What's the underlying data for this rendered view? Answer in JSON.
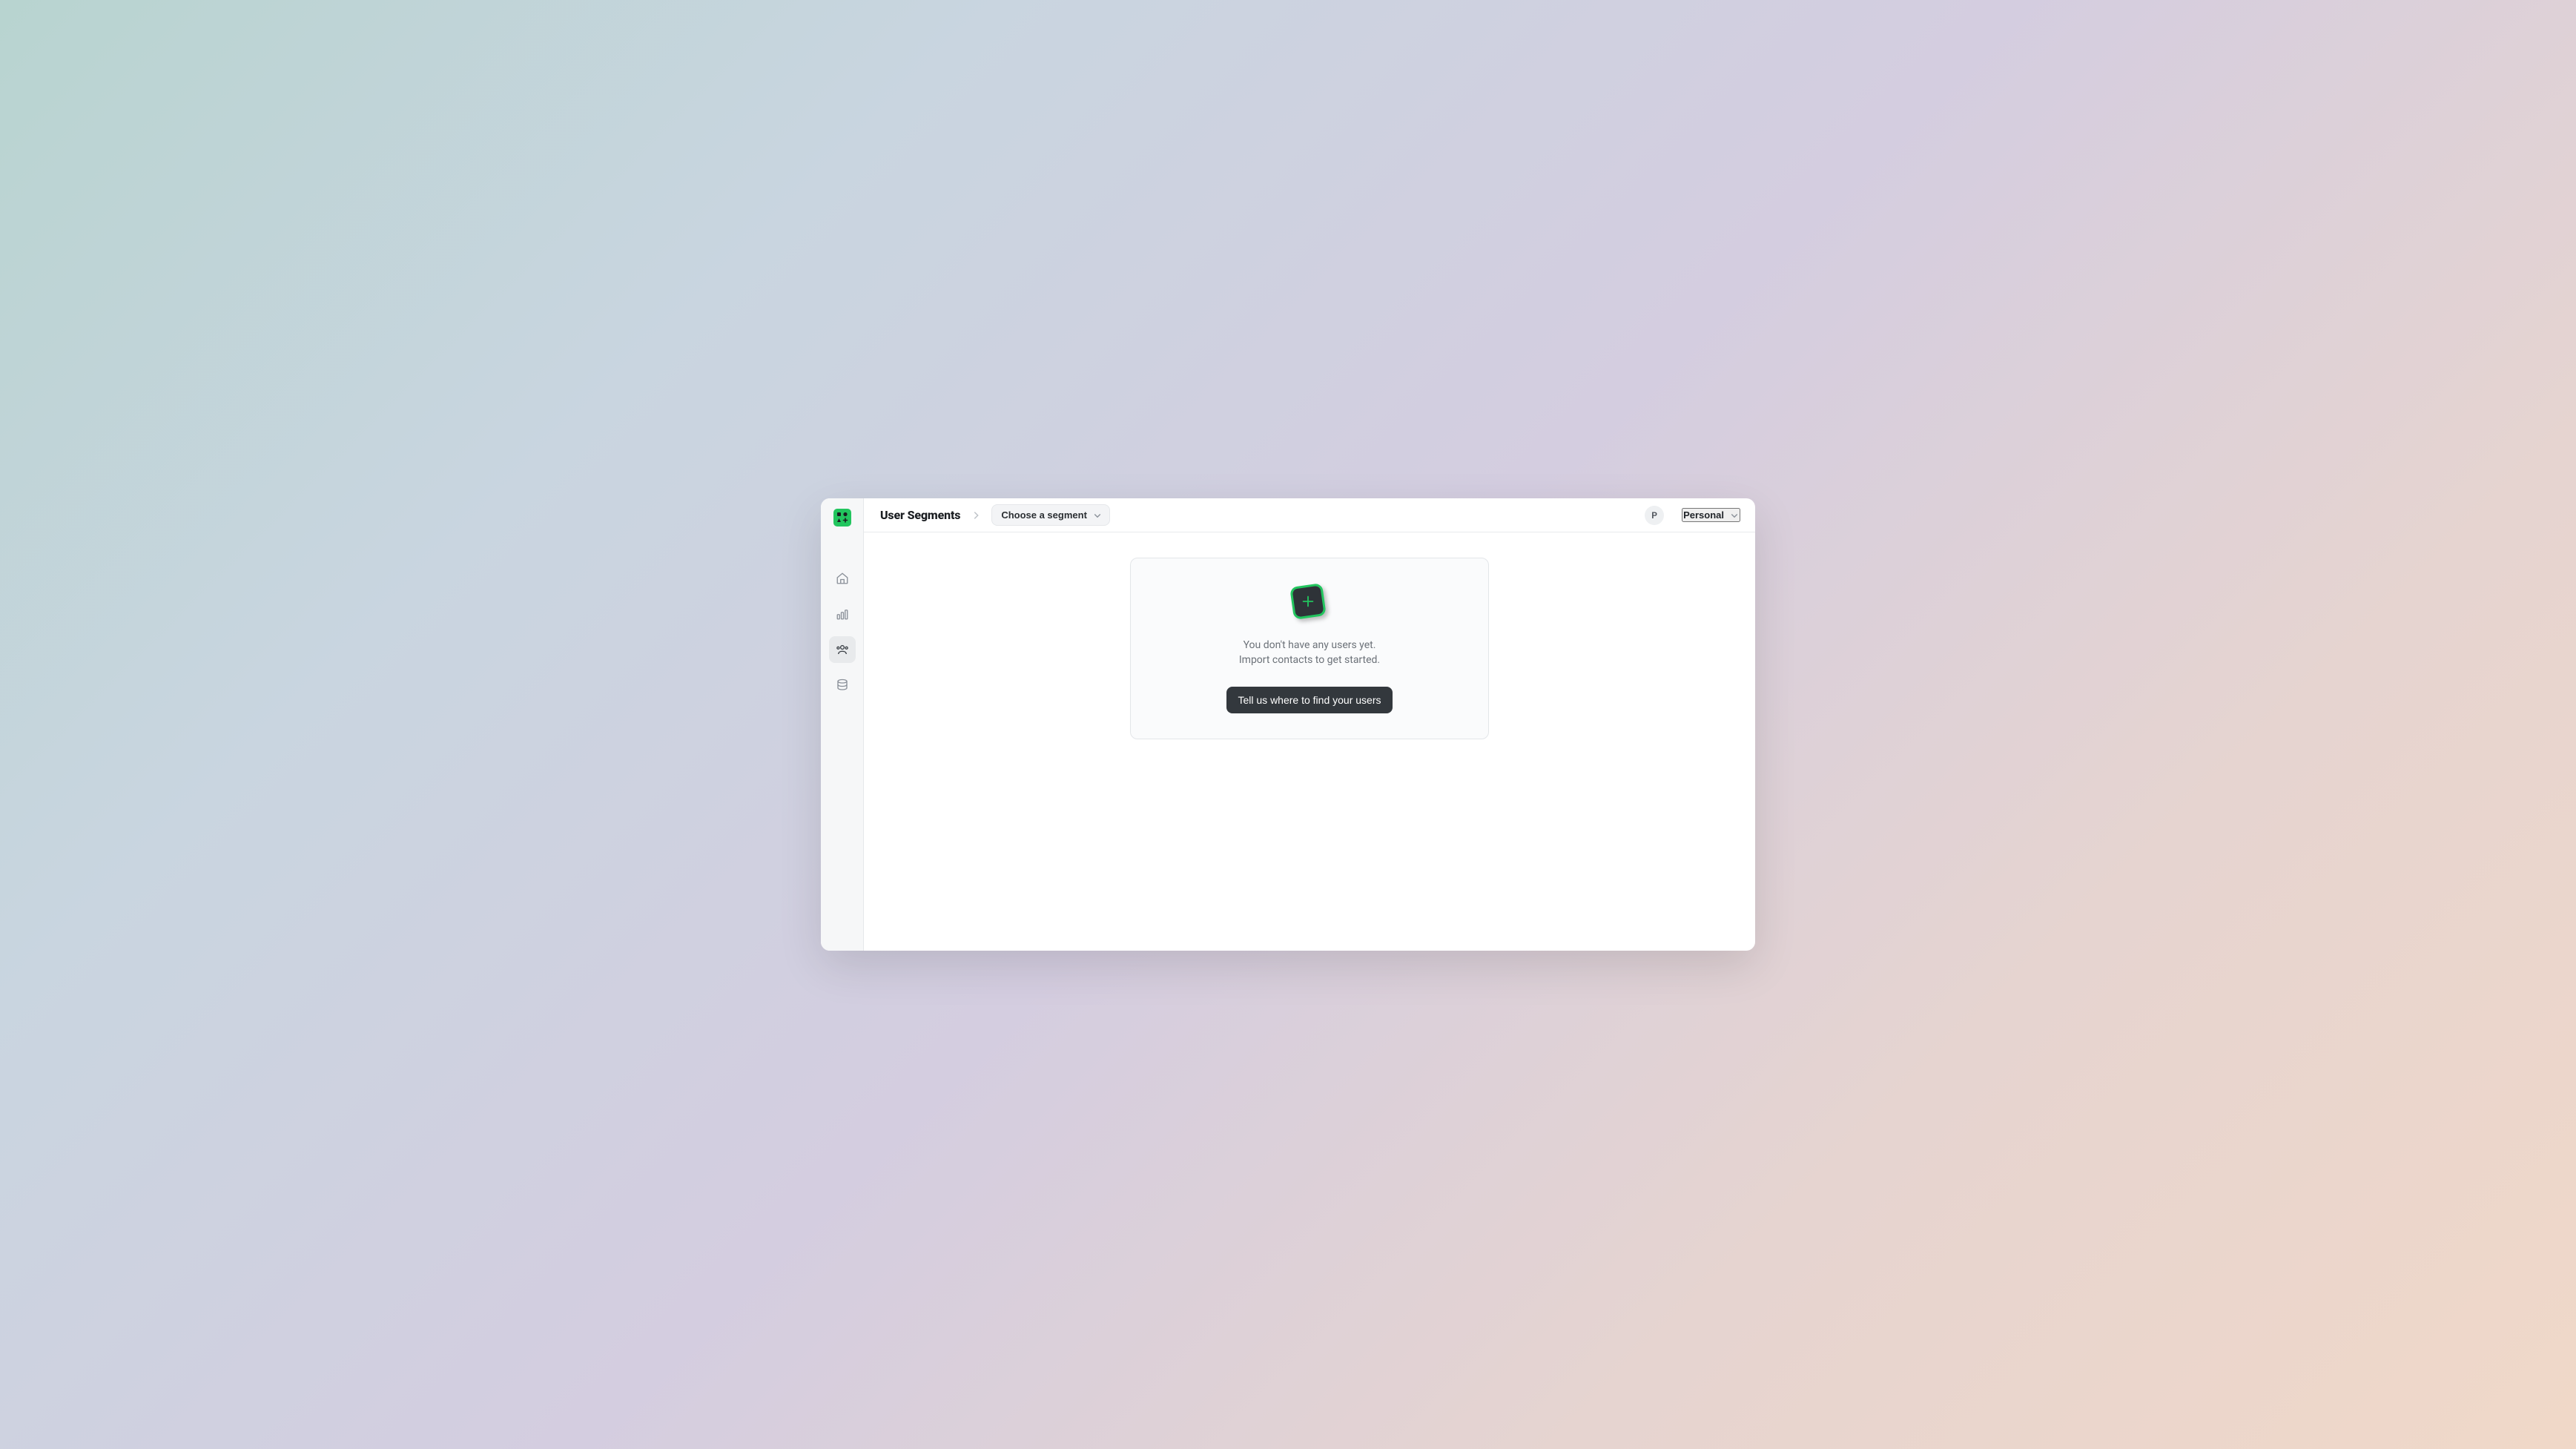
{
  "header": {
    "title": "User Segments",
    "segment_dropdown_label": "Choose a segment",
    "avatar_initial": "P",
    "workspace_label": "Personal"
  },
  "sidebar": {
    "items": [
      {
        "name": "home",
        "active": false
      },
      {
        "name": "analytics",
        "active": false
      },
      {
        "name": "users",
        "active": true
      },
      {
        "name": "database",
        "active": false
      }
    ]
  },
  "empty_state": {
    "line1": "You don't have any users yet.",
    "line2": "Import contacts to get started.",
    "cta": "Tell us where to find your users"
  }
}
